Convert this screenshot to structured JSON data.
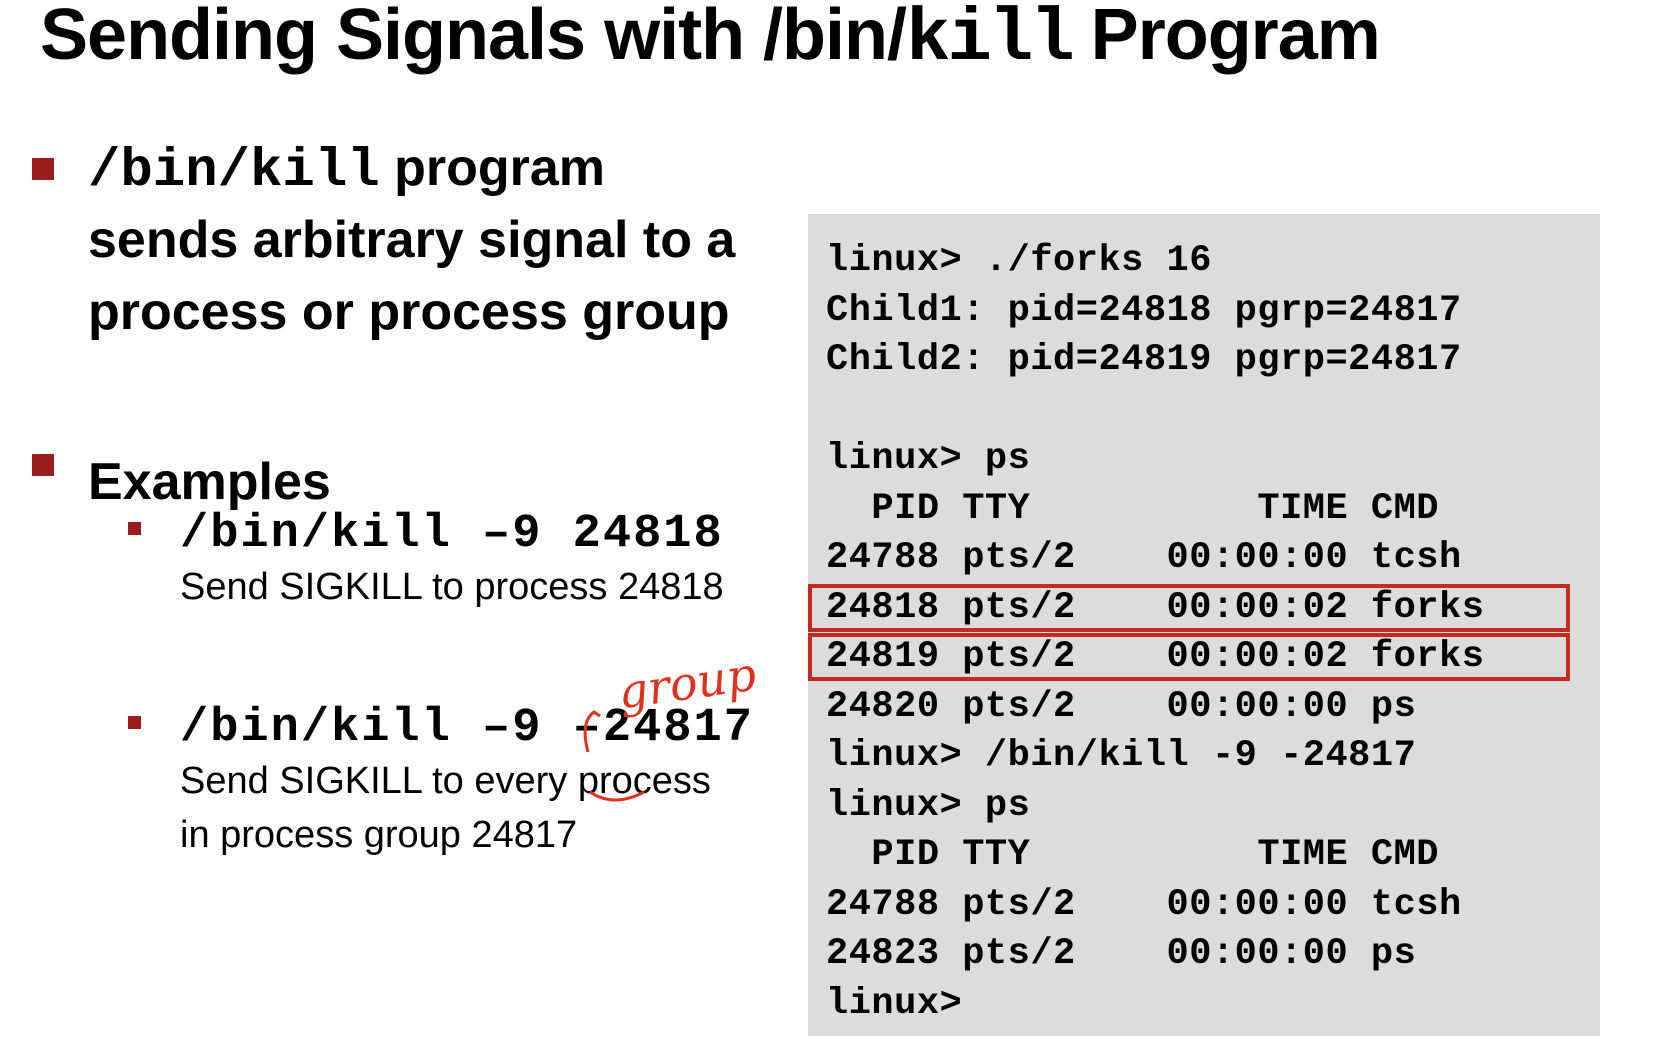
{
  "title": {
    "prefix": "Sending Signals with /bin/",
    "code": "kill",
    "suffix": " Program"
  },
  "bullet1": {
    "code": "/bin/kill",
    "text1": " program",
    "line2": "sends arbitrary signal to a",
    "line3": "process or process group"
  },
  "bullet2": {
    "heading": "Examples",
    "examples": [
      {
        "command": "/bin/kill –9 24818",
        "desc": [
          "Send SIGKILL to process 24818"
        ]
      },
      {
        "command_prefix": "/bin/kill –9 ",
        "command_arg": "–24817",
        "desc": [
          "Send SIGKILL to every process",
          "in process group 24817"
        ]
      }
    ]
  },
  "annotation": {
    "text": "group",
    "color": "#e0311c"
  },
  "terminal": {
    "lines": [
      "linux> ./forks 16",
      "Child1: pid=24818 pgrp=24817",
      "Child2: pid=24819 pgrp=24817",
      "",
      "linux> ps",
      "  PID TTY          TIME CMD",
      "24788 pts/2    00:00:00 tcsh",
      "24818 pts/2    00:00:02 forks",
      "24819 pts/2    00:00:02 forks",
      "24820 pts/2    00:00:00 ps",
      "linux> /bin/kill -9 -24817",
      "linux> ps",
      "  PID TTY          TIME CMD",
      "24788 pts/2    00:00:00 tcsh",
      "24823 pts/2    00:00:00 ps",
      "linux>"
    ],
    "highlighted_lines": [
      7,
      8
    ],
    "background": "#dcdcdc",
    "highlight_color": "#c42a1d"
  },
  "colors": {
    "bullet": "#9b1c1c"
  }
}
